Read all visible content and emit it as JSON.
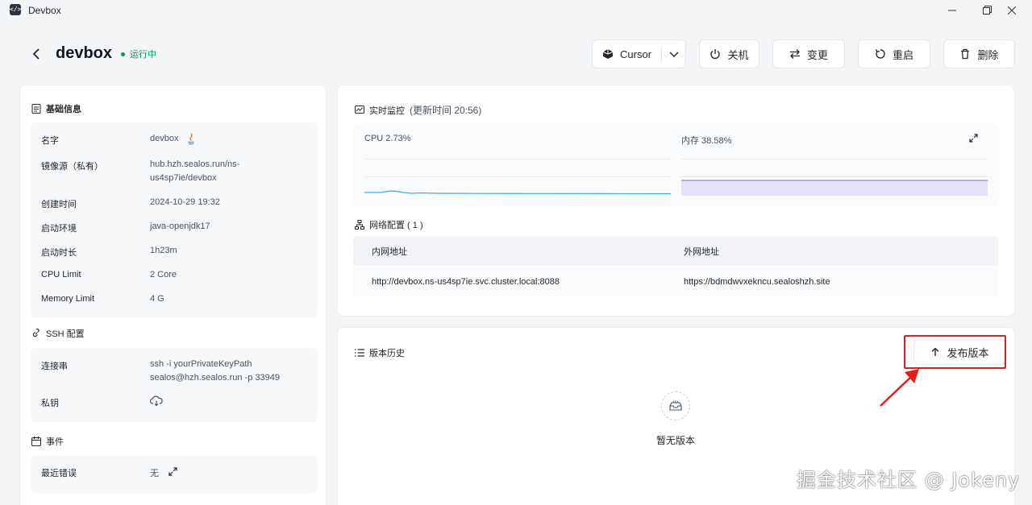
{
  "app": {
    "name": "Devbox",
    "logo_text": "</>"
  },
  "header": {
    "title": "devbox",
    "status": "运行中",
    "status_color": "#039855",
    "ide_button": "Cursor",
    "shutdown_button": "关机",
    "change_button": "变更",
    "restart_button": "重启",
    "delete_button": "删除"
  },
  "basic_info": {
    "title": "基础信息",
    "rows": [
      {
        "label": "名字",
        "value": "devbox"
      },
      {
        "label": "镜像源（私有）",
        "value": "hub.hzh.sealos.run/ns-",
        "value2": "us4sp7ie/devbox"
      },
      {
        "label": "创建时间",
        "value": "2024-10-29 19:32"
      },
      {
        "label": "启动环境",
        "value": "java-openjdk17"
      },
      {
        "label": "启动时长",
        "value": "1h23m"
      },
      {
        "label": "CPU Limit",
        "value": "2 Core"
      },
      {
        "label": "Memory Limit",
        "value": "4 G"
      }
    ]
  },
  "ssh": {
    "title": "SSH 配置",
    "conn_label": "连接串",
    "conn_value1": "ssh -i yourPrivateKeyPath",
    "conn_value2": "sealos@hzh.sealos.run -p 33949",
    "key_label": "私钥"
  },
  "events": {
    "title": "事件",
    "last_error_label": "最近错误",
    "last_error_value": "无"
  },
  "monitor": {
    "title": "实时监控",
    "update_label": "(更新时间  20:56)",
    "cpu_label": "CPU 2.73%",
    "cpu_percent": 2.73,
    "mem_label": "内存 38.58%",
    "mem_percent": 38.58,
    "cpu_color": "#36adef",
    "mem_color": "#8172d8"
  },
  "network": {
    "title": "网络配置 ( 1 )",
    "col_internal": "内网地址",
    "col_external": "外网地址",
    "internal": "http://devbox.ns-us4sp7ie.svc.cluster.local:8088",
    "external": "https://bdmdwvxekncu.sealoshzh.site"
  },
  "versions": {
    "title": "版本历史",
    "release_button": "发布版本",
    "empty_text": "暂无版本",
    "highlight_color": "#e51c1c"
  },
  "watermark": "掘金技术社区 @ Jokeny"
}
